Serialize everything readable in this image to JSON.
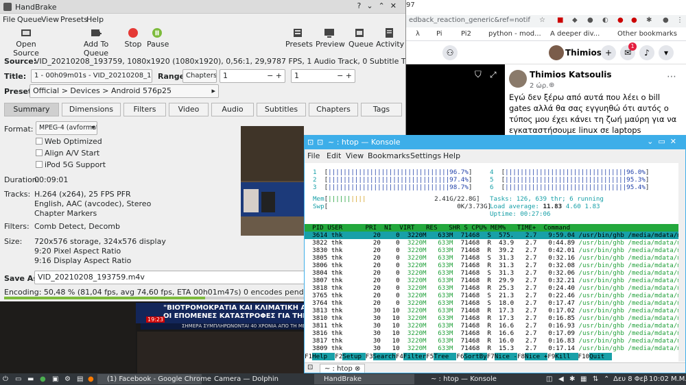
{
  "chrome": {
    "tab_counter": "97",
    "url": "edback_reaction_generic&ref=notif",
    "bookmarks": [
      "λ",
      "Pi",
      "Pi2",
      "python - mod...",
      "A deeper div...",
      "Other bookmarks"
    ],
    "profile_name": "Thimios",
    "notification_count": "1",
    "post": {
      "author": "Thimios Katsoulis",
      "time": "2 ώρ.",
      "text": "Εγώ δεν ξέρω από αυτά που λέει ο bill gates αλλά θα σας εγγυηθώ ότι αυτός ο τύπος μου έχει κάνει τη ζωή μαύρη για να εγκαταστήσουμε linux σε laptops"
    }
  },
  "handbrake": {
    "title": "HandBrake",
    "menu": [
      "File",
      "Queue",
      "View",
      "Presets",
      "Help"
    ],
    "toolbar": {
      "open_source": "Open Source",
      "add_to_queue": "Add To Queue",
      "stop": "Stop",
      "pause": "Pause",
      "presets": "Presets",
      "preview": "Preview",
      "queue": "Queue",
      "activity": "Activity"
    },
    "source_label": "Source:",
    "source_value": "VID_20210208_193759, 1080x1920 (1080x1920), 0,56:1, 29,9787 FPS, 1 Audio Track, 0 Subtitle Tracks",
    "title_label": "Title:",
    "title_value": "1 - 00h09m01s - VID_20210208_1...",
    "range_label": "Range:",
    "range_mode": "Chapters:",
    "range_start": "1",
    "range_end": "1",
    "preset_label": "Preset:",
    "preset_value": "Official > Devices > Android 576p25",
    "tabs": [
      "Summary",
      "Dimensions",
      "Filters",
      "Video",
      "Audio",
      "Subtitles",
      "Chapters",
      "Tags"
    ],
    "active_tab": "Summary",
    "format_label": "Format:",
    "format_value": "MPEG-4 (avformat)",
    "options": {
      "web_optimized": "Web Optimized",
      "align_av": "Align A/V Start",
      "ipod": "iPod 5G Support"
    },
    "duration_label": "Duration:",
    "duration_value": "00:09:01",
    "tracks_label": "Tracks:",
    "tracks": [
      "H.264 (x264), 25 FPS PFR",
      "English, AAC (avcodec), Stereo",
      "Chapter Markers"
    ],
    "filters_label": "Filters:",
    "filters_value": "Comb Detect, Decomb",
    "size_label": "Size:",
    "size_lines": [
      "720x576 storage, 324x576 display",
      "9:20 Pixel Aspect Ratio",
      "9:16 Display Aspect Ratio"
    ],
    "save_as_label": "Save As:",
    "save_as_value": "VID_20210208_193759.m4v",
    "encoding_status": "Encoding: 50,48 % (81,04 fps, avg 74,60 fps, ETA 00h01m47s) 0 encodes pending",
    "progress_fraction": 0.5048
  },
  "camera": {
    "headline1": "\"ΒΙΟΤΡΟΜΟΚΡΑΤΙΑ ΚΑΙ ΚΛΙΜΑΤΙΚΗ ΑΛΛΑΓΗ\"",
    "headline2": "ΟΙ ΕΠΟΜΕΝΕΣ ΚΑΤΑΣΤΡΟΦΕΣ ΓΙΑ ΤΗΝ ΑΝΘΡΩ",
    "ticker": "ΣΗΜΕΡΑ ΣΥΜΠΛΗΡΩΝΟΝΤΑΙ 40 ΧΡΟΝΙΑ ΑΠΟ ΤΗ ΜΕΓΑΛΥΤΕ",
    "clock": "19:23"
  },
  "konsole": {
    "title": "~ : htop — Konsole",
    "menu": [
      "File",
      "Edit",
      "View",
      "Bookmarks",
      "Settings",
      "Help"
    ],
    "tab_label": "~ : htop",
    "cpus": [
      {
        "id": "1",
        "pct": "96.7%"
      },
      {
        "id": "2",
        "pct": "97.4%"
      },
      {
        "id": "3",
        "pct": "98.7%"
      },
      {
        "id": "4",
        "pct": "96.0%"
      },
      {
        "id": "5",
        "pct": "95.3%"
      },
      {
        "id": "6",
        "pct": "95.4%"
      }
    ],
    "mem_label": "Mem",
    "mem_value": "2.41G/22.8G",
    "swp_label": "Swp",
    "swp_value": "0K/3.73G",
    "tasks_line": "Tasks: 126, 639 thr; 6 running",
    "load_label": "Load average:",
    "load_values": [
      "11.83",
      "4.60",
      "1.83"
    ],
    "uptime_line": "Uptime: 00:27:06",
    "header": "  PID USER      PRI  NI  VIRT   RES   SHR S CPU% MEM%   TIME+  Command",
    "processes": [
      {
        "pid": "3614",
        "user": "thk",
        "pri": "20",
        "ni": "0",
        "virt": "3220M",
        "res": "633M",
        "shr": "71468",
        "s": "S",
        "cpu": "575.",
        "mem": "2.7",
        "time": "9:59.04",
        "cmd": "/usr/bin/ghb /media/mdata/m"
      },
      {
        "pid": "3822",
        "user": "thk",
        "pri": "20",
        "ni": "0",
        "virt": "3220M",
        "res": "633M",
        "shr": "71468",
        "s": "R",
        "cpu": "43.9",
        "mem": "2.7",
        "time": "0:44.89",
        "cmd": "/usr/bin/ghb /media/mdata/m"
      },
      {
        "pid": "3830",
        "user": "thk",
        "pri": "20",
        "ni": "0",
        "virt": "3220M",
        "res": "633M",
        "shr": "71468",
        "s": "R",
        "cpu": "39.2",
        "mem": "2.7",
        "time": "0:42.01",
        "cmd": "/usr/bin/ghb /media/mdata/m"
      },
      {
        "pid": "3805",
        "user": "thk",
        "pri": "20",
        "ni": "0",
        "virt": "3220M",
        "res": "633M",
        "shr": "71468",
        "s": "S",
        "cpu": "31.3",
        "mem": "2.7",
        "time": "0:32.16",
        "cmd": "/usr/bin/ghb /media/mdata/m"
      },
      {
        "pid": "3806",
        "user": "thk",
        "pri": "20",
        "ni": "0",
        "virt": "3220M",
        "res": "633M",
        "shr": "71468",
        "s": "R",
        "cpu": "31.3",
        "mem": "2.7",
        "time": "0:32.08",
        "cmd": "/usr/bin/ghb /media/mdata/m"
      },
      {
        "pid": "3804",
        "user": "thk",
        "pri": "20",
        "ni": "0",
        "virt": "3220M",
        "res": "633M",
        "shr": "71468",
        "s": "S",
        "cpu": "31.3",
        "mem": "2.7",
        "time": "0:32.06",
        "cmd": "/usr/bin/ghb /media/mdata/m"
      },
      {
        "pid": "3807",
        "user": "thk",
        "pri": "20",
        "ni": "0",
        "virt": "3220M",
        "res": "633M",
        "shr": "71468",
        "s": "R",
        "cpu": "29.9",
        "mem": "2.7",
        "time": "0:32.21",
        "cmd": "/usr/bin/ghb /media/mdata/m"
      },
      {
        "pid": "3818",
        "user": "thk",
        "pri": "20",
        "ni": "0",
        "virt": "3220M",
        "res": "633M",
        "shr": "71468",
        "s": "R",
        "cpu": "25.3",
        "mem": "2.7",
        "time": "0:24.40",
        "cmd": "/usr/bin/ghb /media/mdata/m"
      },
      {
        "pid": "3765",
        "user": "thk",
        "pri": "20",
        "ni": "0",
        "virt": "3220M",
        "res": "633M",
        "shr": "71468",
        "s": "S",
        "cpu": "21.3",
        "mem": "2.7",
        "time": "0:22.46",
        "cmd": "/usr/bin/ghb /media/mdata/m"
      },
      {
        "pid": "3764",
        "user": "thk",
        "pri": "20",
        "ni": "0",
        "virt": "3220M",
        "res": "633M",
        "shr": "71468",
        "s": "S",
        "cpu": "18.0",
        "mem": "2.7",
        "time": "0:17.47",
        "cmd": "/usr/bin/ghb /media/mdata/m"
      },
      {
        "pid": "3813",
        "user": "thk",
        "pri": "30",
        "ni": "10",
        "virt": "3220M",
        "res": "633M",
        "shr": "71468",
        "s": "R",
        "cpu": "17.3",
        "mem": "2.7",
        "time": "0:17.02",
        "cmd": "/usr/bin/ghb /media/mdata/m"
      },
      {
        "pid": "3810",
        "user": "thk",
        "pri": "30",
        "ni": "10",
        "virt": "3220M",
        "res": "633M",
        "shr": "71468",
        "s": "R",
        "cpu": "17.3",
        "mem": "2.7",
        "time": "0:16.85",
        "cmd": "/usr/bin/ghb /media/mdata/m"
      },
      {
        "pid": "3811",
        "user": "thk",
        "pri": "30",
        "ni": "10",
        "virt": "3220M",
        "res": "633M",
        "shr": "71468",
        "s": "R",
        "cpu": "16.6",
        "mem": "2.7",
        "time": "0:16.93",
        "cmd": "/usr/bin/ghb /media/mdata/m"
      },
      {
        "pid": "3816",
        "user": "thk",
        "pri": "30",
        "ni": "10",
        "virt": "3220M",
        "res": "633M",
        "shr": "71468",
        "s": "R",
        "cpu": "16.6",
        "mem": "2.7",
        "time": "0:17.09",
        "cmd": "/usr/bin/ghb /media/mdata/m"
      },
      {
        "pid": "3817",
        "user": "thk",
        "pri": "30",
        "ni": "10",
        "virt": "3220M",
        "res": "633M",
        "shr": "71468",
        "s": "R",
        "cpu": "16.0",
        "mem": "2.7",
        "time": "0:16.83",
        "cmd": "/usr/bin/ghb /media/mdata/m"
      },
      {
        "pid": "3809",
        "user": "thk",
        "pri": "30",
        "ni": "10",
        "virt": "3220M",
        "res": "633M",
        "shr": "71468",
        "s": "R",
        "cpu": "15.3",
        "mem": "2.7",
        "time": "0:17.14",
        "cmd": "/usr/bin/ghb /media/mdata/m"
      }
    ],
    "fkeys": [
      {
        "key": "F1",
        "label": "Help  "
      },
      {
        "key": "F2",
        "label": "Setup "
      },
      {
        "key": "F3",
        "label": "Search"
      },
      {
        "key": "F4",
        "label": "Filter"
      },
      {
        "key": "F5",
        "label": "Tree  "
      },
      {
        "key": "F6",
        "label": "SortBy"
      },
      {
        "key": "F7",
        "label": "Nice -"
      },
      {
        "key": "F8",
        "label": "Nice +"
      },
      {
        "key": "F9",
        "label": "Kill  "
      },
      {
        "key": "F10",
        "label": "Quit  "
      }
    ]
  },
  "taskbar": {
    "tasks": [
      "(1) Facebook - Google Chrome",
      "Camera — Dolphin",
      "HandBrake",
      "~ : htop — Konsole"
    ],
    "date": "Δευ 8 Φεβ",
    "time": "10:02 Μ.Μ."
  }
}
